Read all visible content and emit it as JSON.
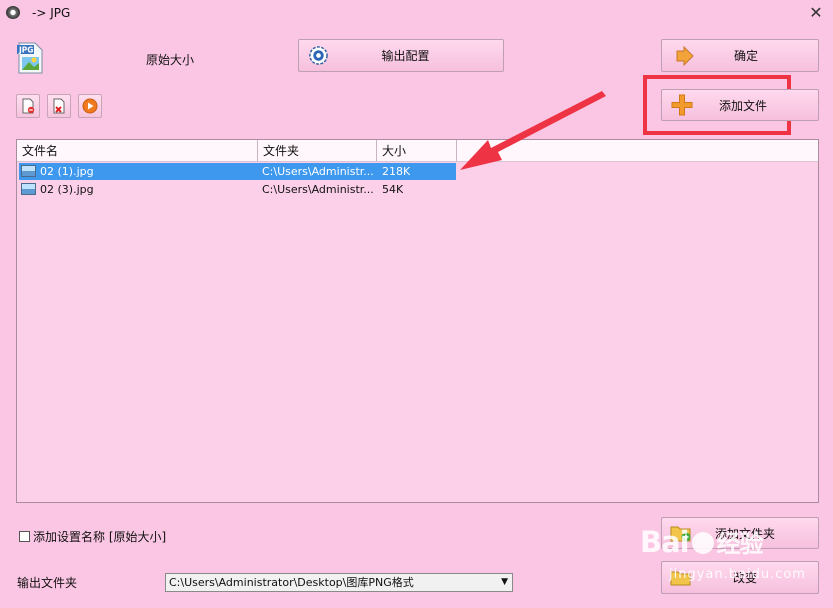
{
  "window": {
    "title": "-> JPG"
  },
  "top": {
    "preset_label": "原始大小",
    "output_config_label": "输出配置",
    "ok_label": "确定",
    "add_file_label": "添加文件"
  },
  "list": {
    "columns": [
      "文件名",
      "文件夹",
      "大小"
    ],
    "rows": [
      {
        "name": "02 (1).jpg",
        "folder": "C:\\Users\\Administr...",
        "size": "218K",
        "selected": true
      },
      {
        "name": "02 (3).jpg",
        "folder": "C:\\Users\\Administr...",
        "size": "54K",
        "selected": false
      }
    ]
  },
  "bottom": {
    "checkbox_label": "添加设置名称 [原始大小]",
    "add_folder_label": "添加文件夹",
    "output_folder_label": "输出文件夹",
    "output_folder_value": "C:\\Users\\Administrator\\Desktop\\图库PNG格式",
    "change_label": "改变"
  },
  "watermark": {
    "brand": "Bai",
    "brand2": "经验",
    "url": "jingyan.baidu.com"
  },
  "colors": {
    "background": "#fbc6e3",
    "selection": "#3d98ee",
    "highlight": "#ee3344"
  }
}
